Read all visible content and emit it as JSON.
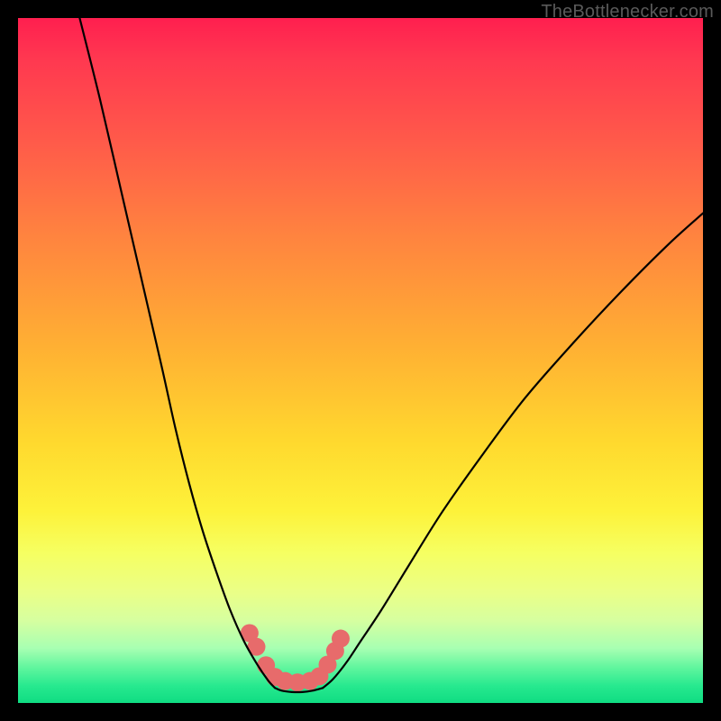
{
  "watermark": "TheBottlenecker.com",
  "chart_data": {
    "type": "line",
    "title": "",
    "xlabel": "",
    "ylabel": "",
    "xlim": [
      0,
      100
    ],
    "ylim": [
      0,
      100
    ],
    "series": [
      {
        "name": "left-curve",
        "x": [
          9,
          12,
          15,
          18,
          21,
          23,
          25,
          27,
          29,
          31,
          33,
          35,
          36.5,
          37.5
        ],
        "y": [
          100,
          88,
          75,
          62,
          49,
          40,
          32,
          25,
          19,
          13.5,
          9,
          5.5,
          3.3,
          2.2
        ]
      },
      {
        "name": "right-curve",
        "x": [
          44.5,
          46,
          48,
          50,
          53,
          57,
          62,
          68,
          74,
          81,
          88,
          95,
          100
        ],
        "y": [
          2.2,
          3.5,
          6,
          9,
          13.5,
          20,
          28,
          36.5,
          44.5,
          52.5,
          60,
          67,
          71.5
        ]
      },
      {
        "name": "plateau",
        "x": [
          37.5,
          38.5,
          40,
          41.5,
          43,
          44.5
        ],
        "y": [
          2.2,
          1.8,
          1.6,
          1.6,
          1.8,
          2.2
        ]
      }
    ],
    "markers": {
      "name": "dotted-band",
      "color": "#e76b6b",
      "points": [
        {
          "x": 33.8,
          "y": 10.2
        },
        {
          "x": 34.8,
          "y": 8.2
        },
        {
          "x": 36.2,
          "y": 5.5
        },
        {
          "x": 37.5,
          "y": 3.8
        },
        {
          "x": 39.0,
          "y": 3.2
        },
        {
          "x": 40.8,
          "y": 3.0
        },
        {
          "x": 42.6,
          "y": 3.2
        },
        {
          "x": 44.0,
          "y": 3.9
        },
        {
          "x": 45.2,
          "y": 5.6
        },
        {
          "x": 46.3,
          "y": 7.6
        },
        {
          "x": 47.1,
          "y": 9.4
        }
      ],
      "radius": 10
    },
    "colors": {
      "curve_stroke": "#000000",
      "marker_fill": "#e76b6b",
      "gradient_top": "#ff1f4f",
      "gradient_bottom": "#0fdc82"
    }
  }
}
